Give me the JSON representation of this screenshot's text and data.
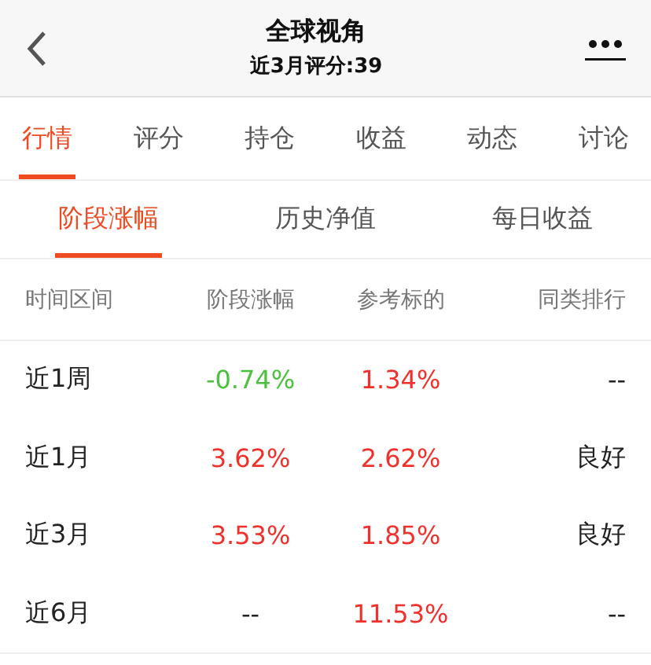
{
  "nav_bar": {
    "title": "全球视角",
    "subtitle": "近3月评分:39"
  },
  "tabs": [
    {
      "label": "行情",
      "selected": true
    },
    {
      "label": "评分",
      "selected": false
    },
    {
      "label": "持仓",
      "selected": false
    },
    {
      "label": "收益",
      "selected": false
    },
    {
      "label": "动态",
      "selected": false
    },
    {
      "label": "讨论",
      "selected": false
    }
  ],
  "sub_tabs": [
    {
      "label": "阶段涨幅",
      "selected": true
    },
    {
      "label": "历史净值",
      "selected": false
    },
    {
      "label": "每日收益",
      "selected": false
    }
  ],
  "table": {
    "columns": [
      "时间区间",
      "阶段涨幅",
      "参考标的",
      "同类排行"
    ],
    "rows": [
      {
        "period": "近1周",
        "change": {
          "text": "-0.74%",
          "color": "#4cc13d"
        },
        "benchmark": {
          "text": "1.34%",
          "color": "#f0302a"
        },
        "rank": "--"
      },
      {
        "period": "近1月",
        "change": {
          "text": "3.62%",
          "color": "#f0302a"
        },
        "benchmark": {
          "text": "2.62%",
          "color": "#f0302a"
        },
        "rank": "良好"
      },
      {
        "period": "近3月",
        "change": {
          "text": "3.53%",
          "color": "#f0302a"
        },
        "benchmark": {
          "text": "1.85%",
          "color": "#f0302a"
        },
        "rank": "良好"
      },
      {
        "period": "近6月",
        "change": {
          "text": "--",
          "color": "#222222"
        },
        "benchmark": {
          "text": "11.53%",
          "color": "#f0302a"
        },
        "rank": "--"
      }
    ]
  }
}
